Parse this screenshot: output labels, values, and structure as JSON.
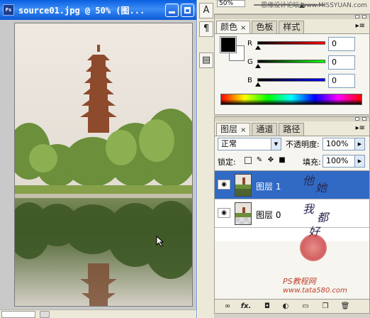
{
  "document": {
    "title": "source01.jpg @ 50% (图..."
  },
  "options_bar": {
    "percent": "50%",
    "watermark": "思缘设计论坛 www.MISSYUAN.com"
  },
  "strip": {
    "buttons": [
      "A",
      "¶",
      "▤"
    ]
  },
  "color_panel": {
    "tabs": [
      "颜色",
      "色板",
      "样式"
    ],
    "channels": [
      {
        "label": "R",
        "value": "0"
      },
      {
        "label": "G",
        "value": "0"
      },
      {
        "label": "B",
        "value": "0"
      }
    ],
    "fg_color": "#000000",
    "bg_color": "#ffffff"
  },
  "layers_panel": {
    "tabs": [
      "图层",
      "通道",
      "路径"
    ],
    "blend_mode": "正常",
    "opacity_label": "不透明度:",
    "opacity": "100%",
    "lock_label": "锁定:",
    "fill_label": "填充:",
    "fill": "100%",
    "layers": [
      {
        "name": "图层 1",
        "selected": true
      },
      {
        "name": "图层 0",
        "selected": false
      }
    ],
    "bottom_icons": [
      "link-icon",
      "fx-icon",
      "mask-icon",
      "adjustment-icon",
      "group-icon",
      "new-layer-icon",
      "trash-icon"
    ],
    "fx_label": "fx."
  },
  "overlay": {
    "signature_lines": [
      "他",
      "她",
      "我",
      "都",
      "好"
    ],
    "site_line1": "PS教程网",
    "site_line2": "www.tata580.com"
  }
}
